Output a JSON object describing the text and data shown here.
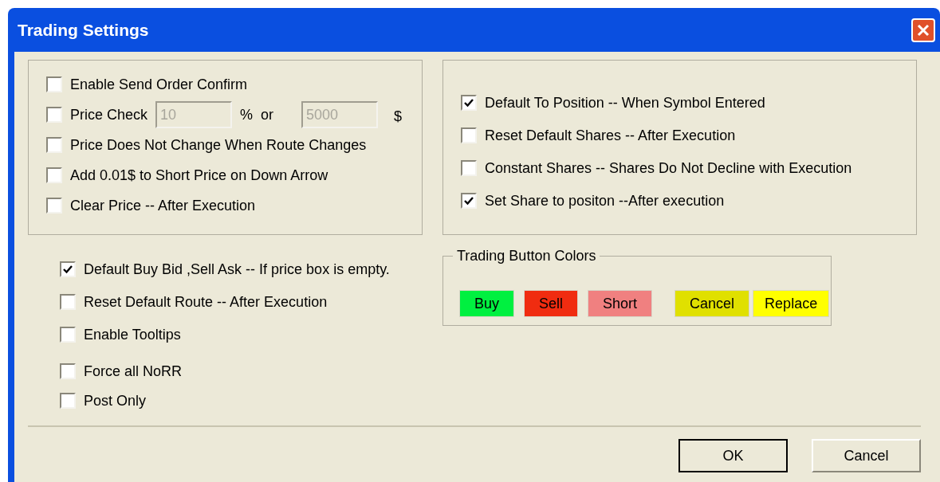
{
  "window": {
    "title": "Trading Settings"
  },
  "order_options": [
    {
      "kind": "checkbox",
      "label": "Enable Send Order Confirm",
      "checked": false
    },
    {
      "kind": "price_check",
      "label": "Price Check",
      "checked": false,
      "percent_field": {
        "value": "10",
        "disabled": true
      },
      "percent_label": "%",
      "or_label": "or",
      "dollar_field": {
        "value": "5000",
        "disabled": true
      },
      "dollar_label": "$"
    },
    {
      "kind": "checkbox",
      "label": "Price Does Not Change When Route Changes",
      "checked": false
    },
    {
      "kind": "checkbox",
      "label": "Add 0.01$ to Short Price on Down Arrow",
      "checked": false
    },
    {
      "kind": "checkbox",
      "label": "Clear Price -- After Execution",
      "checked": false
    }
  ],
  "share_options": [
    {
      "label": "Default To Position -- When Symbol Entered",
      "checked": true
    },
    {
      "label": "Reset Default Shares -- After Execution",
      "checked": false
    },
    {
      "label": "Constant Shares -- Shares Do Not Decline with Execution",
      "checked": false
    },
    {
      "label": "Set Share to positon --After execution",
      "checked": true
    }
  ],
  "general_options": [
    {
      "label": "Default Buy Bid ,Sell Ask -- If price box is empty.",
      "checked": true
    },
    {
      "label": "Reset Default Route -- After Execution",
      "checked": false
    },
    {
      "label": "Enable Tooltips",
      "checked": false
    },
    {
      "label": "Force all NoRR",
      "checked": false
    },
    {
      "label": "Post Only",
      "checked": false
    }
  ],
  "trading_button_colors": {
    "title": "Trading Button Colors",
    "buttons": [
      {
        "label": "Buy",
        "color": "#00f040"
      },
      {
        "label": "Sell",
        "color": "#f02c10"
      },
      {
        "label": "Short",
        "color": "#f08080"
      },
      {
        "label": "Cancel",
        "color": "#e0e000"
      },
      {
        "label": "Replace",
        "color": "#ffff00"
      }
    ]
  },
  "buttons": [
    {
      "label": "OK",
      "default": true
    },
    {
      "label": "Cancel",
      "default": false
    }
  ]
}
